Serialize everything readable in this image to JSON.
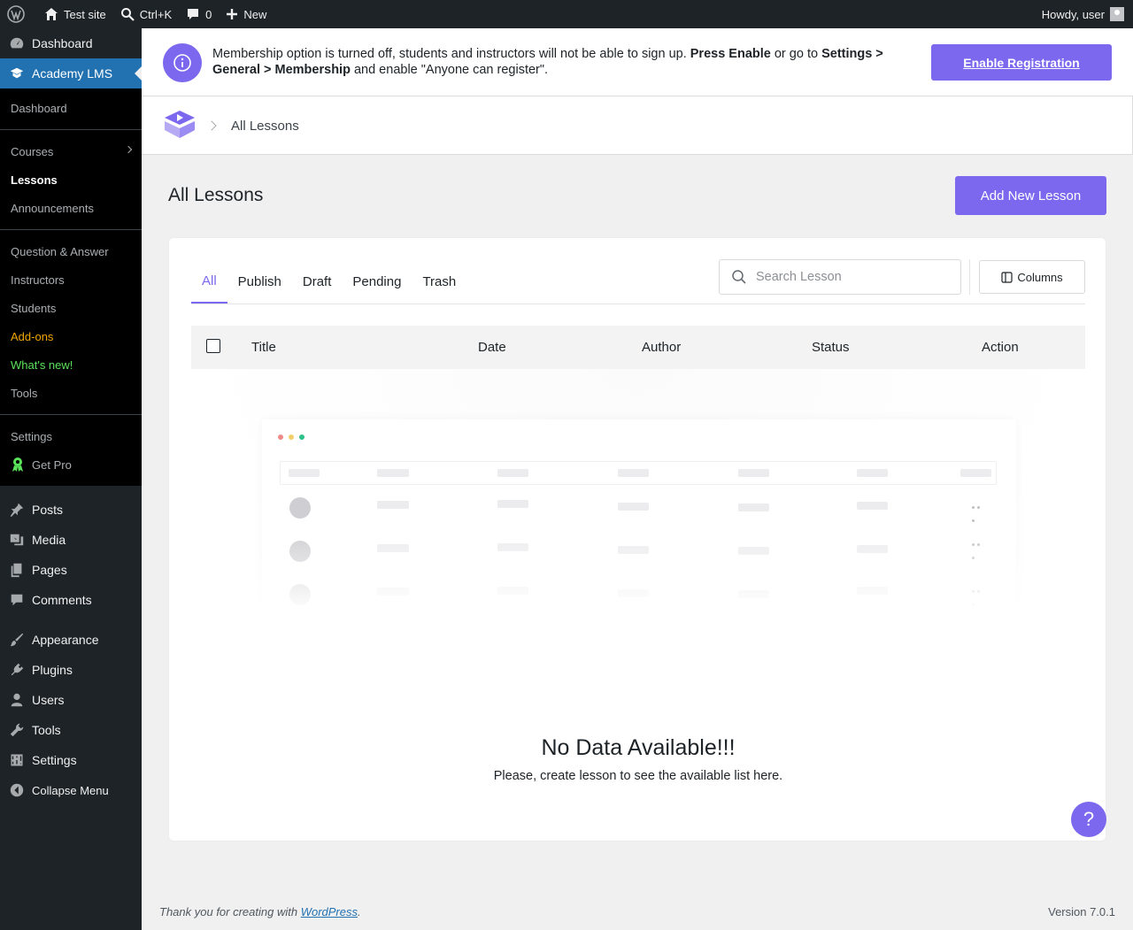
{
  "adminbar": {
    "site_name": "Test site",
    "search_shortcut": "Ctrl+K",
    "comments_count": "0",
    "new_label": "New",
    "greeting": "Howdy, user"
  },
  "sidebar": {
    "top_dashboard": "Dashboard",
    "academy": "Academy LMS",
    "submenu": {
      "dashboard": "Dashboard",
      "courses": "Courses",
      "lessons": "Lessons",
      "announcements": "Announcements",
      "qa": "Question & Answer",
      "instructors": "Instructors",
      "students": "Students",
      "addons": "Add-ons",
      "whats_new": "What's new!",
      "tools": "Tools",
      "settings": "Settings",
      "get_pro": "Get Pro"
    },
    "posts": "Posts",
    "media": "Media",
    "pages": "Pages",
    "comments": "Comments",
    "appearance": "Appearance",
    "plugins": "Plugins",
    "users": "Users",
    "tools": "Tools",
    "settings": "Settings",
    "collapse": "Collapse Menu"
  },
  "notice": {
    "text_1": "Membership option is turned off, students and instructors will not be able to sign up. ",
    "bold_1": "Press Enable",
    "text_2": " or go to ",
    "bold_2": "Settings > General > Membership",
    "text_3": " and enable \"Anyone can register\".",
    "button": "Enable Registration"
  },
  "breadcrumb": {
    "current": "All Lessons"
  },
  "page": {
    "title": "All Lessons",
    "add_button": "Add New Lesson"
  },
  "tabs": [
    "All",
    "Publish",
    "Draft",
    "Pending",
    "Trash"
  ],
  "search": {
    "placeholder": "Search Lesson"
  },
  "columns_button": "Columns",
  "table": {
    "headers": {
      "title": "Title",
      "date": "Date",
      "author": "Author",
      "status": "Status",
      "action": "Action"
    }
  },
  "empty": {
    "title": "No Data Available!!!",
    "subtitle": "Please, create lesson to see the available list here."
  },
  "help": "?",
  "footer": {
    "thanks_prefix": "Thank you for creating with ",
    "wordpress": "WordPress",
    "thanks_suffix": ".",
    "version": "Version 7.0.1"
  },
  "colors": {
    "accent": "#7b68ee",
    "wp_blue": "#2271b1",
    "admin_dark": "#1d2327"
  }
}
